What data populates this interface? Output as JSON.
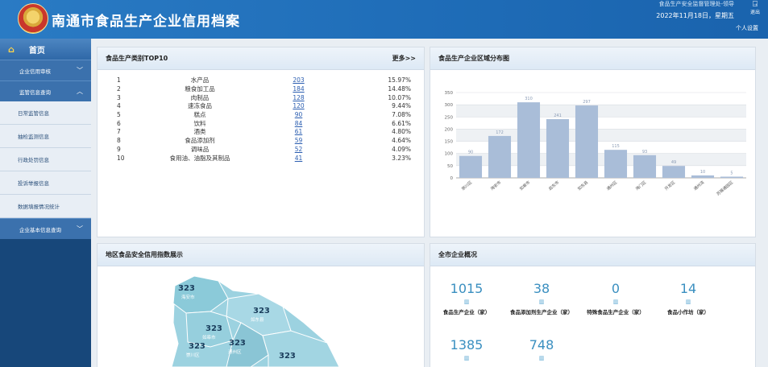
{
  "header": {
    "title": "南通市食品生产企业信用档案",
    "user": "食品生产安全监督管理处-领导",
    "date": "2022年11月18日，星期五",
    "profile": "个人设置",
    "logout_label": "退出"
  },
  "sidebar": {
    "home": "首页",
    "items": [
      {
        "label": "企业信用审核",
        "type": "section",
        "chevron": "﹀"
      },
      {
        "label": "监管信息查询",
        "type": "section",
        "chevron": "︿"
      },
      {
        "label": "日常监管信息",
        "type": "sub"
      },
      {
        "label": "抽检监测信息",
        "type": "sub"
      },
      {
        "label": "行政处罚信息",
        "type": "sub"
      },
      {
        "label": "投诉举报信息",
        "type": "sub"
      },
      {
        "label": "数据填报情况统计",
        "type": "sub"
      },
      {
        "label": "企业基本信息查询",
        "type": "section",
        "chevron": "﹀"
      }
    ]
  },
  "top10": {
    "title": "食品生产类别TOP10",
    "more": "更多>>",
    "rows": [
      {
        "rank": "1",
        "name": "水产品",
        "count": "203",
        "pct": "15.97%"
      },
      {
        "rank": "2",
        "name": "粮食加工品",
        "count": "184",
        "pct": "14.48%"
      },
      {
        "rank": "3",
        "name": "肉制品",
        "count": "128",
        "pct": "10.07%"
      },
      {
        "rank": "4",
        "name": "速冻食品",
        "count": "120",
        "pct": "9.44%"
      },
      {
        "rank": "5",
        "name": "糕点",
        "count": "90",
        "pct": "7.08%"
      },
      {
        "rank": "6",
        "name": "饮料",
        "count": "84",
        "pct": "6.61%"
      },
      {
        "rank": "7",
        "name": "酒类",
        "count": "61",
        "pct": "4.80%"
      },
      {
        "rank": "8",
        "name": "食品添加剂",
        "count": "59",
        "pct": "4.64%"
      },
      {
        "rank": "9",
        "name": "调味品",
        "count": "52",
        "pct": "4.09%"
      },
      {
        "rank": "10",
        "name": "食用油、油脂及其制品",
        "count": "41",
        "pct": "3.23%"
      }
    ]
  },
  "region_panel": {
    "title": "食品生产企业区域分布图"
  },
  "chart_data": {
    "type": "bar",
    "categories": [
      "崇川区",
      "海安市",
      "如皋市",
      "启东市",
      "如东县",
      "通州区",
      "海门区",
      "开发区",
      "通州湾",
      "苏锡通园区"
    ],
    "values": [
      90,
      172,
      310,
      241,
      297,
      115,
      93,
      49,
      10,
      5
    ],
    "ylim": [
      0,
      350
    ],
    "yticks": [
      0,
      50,
      100,
      150,
      200,
      250,
      300,
      350
    ],
    "grid": true,
    "bar_color": "#a9bdd8"
  },
  "map_panel": {
    "title": "地区食品安全信用指数展示",
    "regions": [
      {
        "score": "323",
        "name": "海安市"
      },
      {
        "score": "323",
        "name": "如东县"
      },
      {
        "score": "323",
        "name": "如皋市"
      },
      {
        "score": "323",
        "name": "崇川区"
      },
      {
        "score": "323",
        "name": "通州区"
      },
      {
        "score": "323",
        "name": ""
      }
    ]
  },
  "overview": {
    "title": "全市企业概况",
    "items": [
      {
        "value": "1015",
        "label": "食品生产企业（家）"
      },
      {
        "value": "38",
        "label": "食品添加剂生产企业（家）"
      },
      {
        "value": "0",
        "label": "特殊食品生产企业（家）"
      },
      {
        "value": "14",
        "label": "食品小作坊（家）"
      },
      {
        "value": "1385",
        "label": ""
      },
      {
        "value": "748",
        "label": ""
      }
    ]
  }
}
